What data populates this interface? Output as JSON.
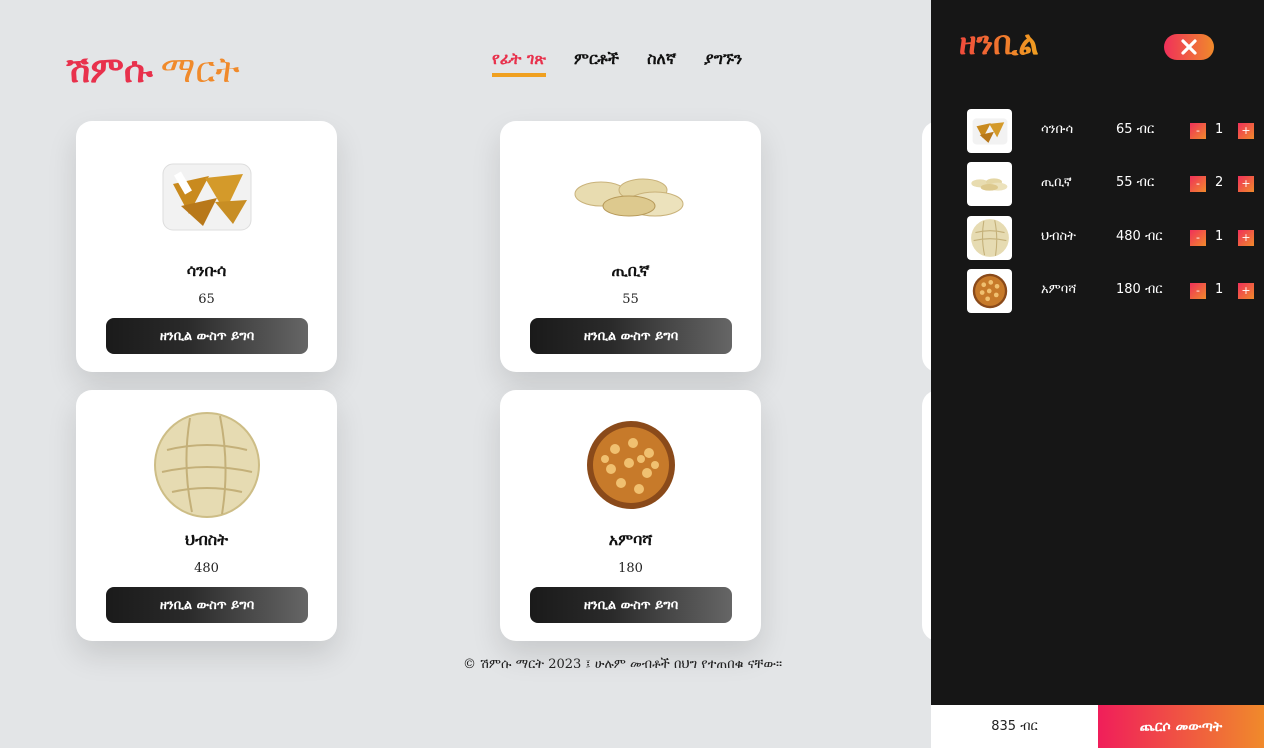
{
  "brand": {
    "part1": "ሽምሱ",
    "part2": "ማርት"
  },
  "nav": [
    {
      "label": "የፊት ገጽ",
      "active": true
    },
    {
      "label": "ምርቶች",
      "active": false
    },
    {
      "label": "ስለኛ",
      "active": false
    },
    {
      "label": "ያግኙን",
      "active": false
    }
  ],
  "products": [
    {
      "name": "ሳንቡሳ",
      "price": "65",
      "button": "ዘንቢል ውስጥ ይግባ",
      "icon": "sambusa-image"
    },
    {
      "name": "ጢቢኛ",
      "price": "55",
      "button": "ዘንቢል ውስጥ ይግባ",
      "icon": "tibiya-image"
    },
    {
      "name": "ህብስት",
      "price": "480",
      "button": "ዘንቢል ውስጥ ይግባ",
      "icon": "hibist-bread-image"
    },
    {
      "name": "አምባሻ",
      "price": "180",
      "button": "ዘንቢል ውስጥ ይግባ",
      "icon": "ambasha-bread-image"
    }
  ],
  "footer": {
    "text": "© ሽምሱ ማርት 2023 ፤ ሁሉም መብቶች በህግ የተጠበቁ ናቸው።"
  },
  "cart": {
    "title": "ዘንቢል",
    "close_icon": "close-icon",
    "items": [
      {
        "name": "ሳንቡሳ",
        "price": "65 ብር",
        "qty": "1"
      },
      {
        "name": "ጢቢኛ",
        "price": "55 ብር",
        "qty": "2"
      },
      {
        "name": "ህብስት",
        "price": "480 ብር",
        "qty": "1"
      },
      {
        "name": "አምባሻ",
        "price": "180 ብር",
        "qty": "1"
      }
    ],
    "minus_label": "-",
    "plus_label": "+",
    "total": "835 ብር",
    "checkout_label": "ጨርሶ መውጣት"
  },
  "colors": {
    "accent_red": "#e8314c",
    "accent_orange": "#f08a2b",
    "panel_bg": "#161616",
    "page_bg": "#e3e5e7"
  }
}
